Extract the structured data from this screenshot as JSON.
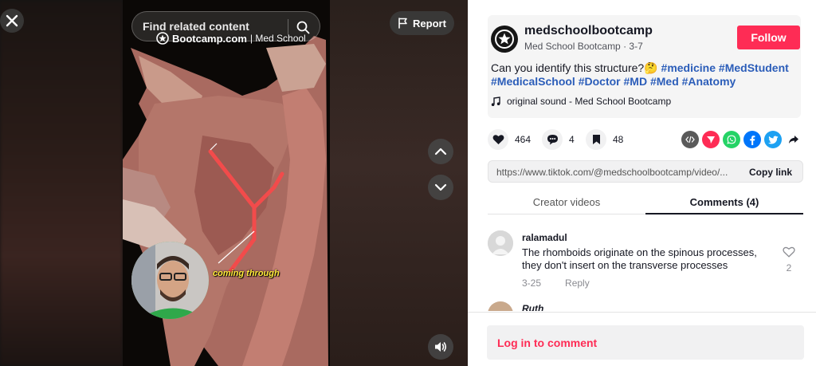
{
  "video": {
    "search_placeholder": "Find related content",
    "watermark_brand": "Bootcamp.com",
    "watermark_suffix": "| Med School",
    "report_label": "Report",
    "caption": "coming through"
  },
  "post": {
    "username": "medschoolbootcamp",
    "display_name": "Med School Bootcamp",
    "date": "3-7",
    "follow_label": "Follow",
    "description_text": "Can you identify this structure?🤔",
    "hashtags": [
      "#medicine",
      "#MedStudent",
      "#MedicalSchool",
      "#Doctor",
      "#MD",
      "#Med",
      "#Anatomy"
    ],
    "music": "original sound - Med School Bootcamp"
  },
  "actions": {
    "likes": "464",
    "comments": "4",
    "saves": "48",
    "share_icons": [
      "embed-icon",
      "send-icon",
      "whatsapp-icon",
      "facebook-icon",
      "twitter-icon",
      "share-arrow-icon"
    ]
  },
  "link": {
    "url": "https://www.tiktok.com/@medschoolbootcamp/video/...",
    "copy_label": "Copy link"
  },
  "tabs": {
    "creator_videos": "Creator videos",
    "comments": "Comments (4)"
  },
  "comments": [
    {
      "user": "ralamadul",
      "text": "The rhomboids originate on the spinous processes, they don't insert on the transverse processes",
      "date": "3-25",
      "reply_label": "Reply",
      "likes": "2"
    },
    {
      "user": "Ruth"
    }
  ],
  "login": {
    "label": "Log in to comment"
  },
  "colors": {
    "brand": "#fe2c55",
    "hashtag": "#2b5db9",
    "text": "#161823"
  }
}
